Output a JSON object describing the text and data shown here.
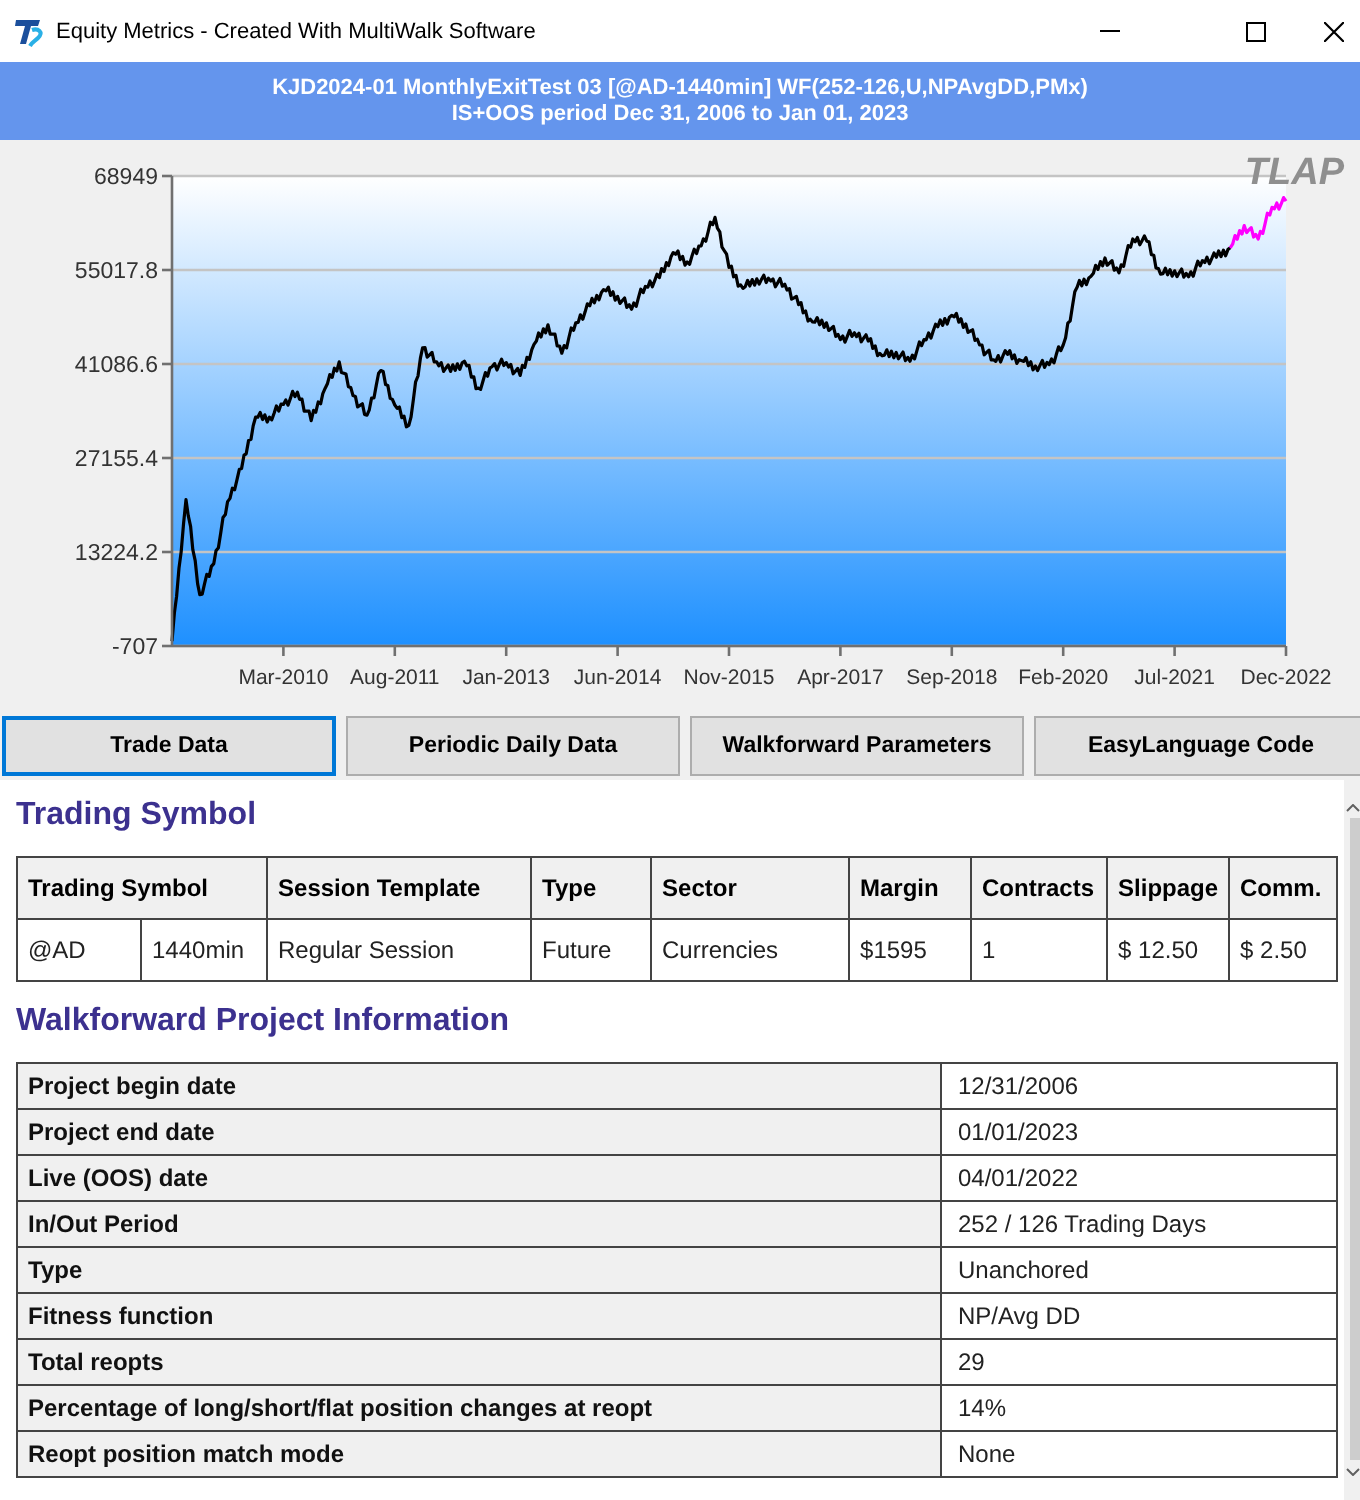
{
  "window": {
    "title": "Equity Metrics - Created With MultiWalk Software"
  },
  "header": {
    "title": "KJD2024-01 MonthlyExitTest 03 [@AD-1440min] WF(252-126,U,NPAvgDD,PMx)",
    "subtitle": "IS+OOS period Dec 31, 2006 to Jan 01, 2023"
  },
  "chart": {
    "corner_label": "TLAP",
    "chart_data": {
      "type": "line",
      "grid": true,
      "categories": [
        null,
        null,
        null,
        null,
        null,
        null,
        null,
        null,
        "Mar-2010",
        null,
        null,
        null,
        null,
        null,
        null,
        null,
        "Aug-2011",
        null,
        null,
        null,
        null,
        null,
        null,
        null,
        "Jan-2013",
        null,
        null,
        null,
        null,
        null,
        null,
        null,
        "Jun-2014",
        null,
        null,
        null,
        null,
        null,
        null,
        null,
        "Nov-2015",
        null,
        null,
        null,
        null,
        null,
        null,
        null,
        "Apr-2017",
        null,
        null,
        null,
        null,
        null,
        null,
        null,
        "Sep-2018",
        null,
        null,
        null,
        null,
        null,
        null,
        null,
        "Feb-2020",
        null,
        null,
        null,
        null,
        null,
        null,
        null,
        "Jul-2021",
        null,
        null,
        null,
        null,
        null,
        null,
        null,
        "Dec-2022"
      ],
      "series": [
        {
          "color": "#000000",
          "values": [
            0,
            21000,
            6900,
            11500,
            20700,
            25600,
            33200,
            33200,
            35100,
            36900,
            32700,
            37500,
            41400,
            36400,
            33500,
            40100,
            35000,
            32000,
            43500,
            41400,
            40000,
            41500,
            37500,
            40700,
            41300,
            39400,
            44000,
            46900,
            42700,
            47200,
            49700,
            52100,
            51100,
            49200,
            52600,
            53900,
            57600,
            56200,
            58600,
            62800,
            55400,
            52300,
            53700,
            53400,
            52900,
            49900,
            47300,
            47200,
            44700,
            45700,
            44500,
            42300,
            42800,
            41500,
            44700,
            46600,
            48300,
            47000,
            43900,
            41700,
            42500,
            41600,
            40800,
            41000,
            43900,
            52500,
            54100,
            56800,
            54600,
            59600,
            59300,
            54400,
            54900,
            54000,
            56400,
            56900,
            58300,
            null,
            null,
            null,
            null
          ]
        },
        {
          "color": "#ff00ff",
          "values": [
            null,
            null,
            null,
            null,
            null,
            null,
            null,
            null,
            null,
            null,
            null,
            null,
            null,
            null,
            null,
            null,
            null,
            null,
            null,
            null,
            null,
            null,
            null,
            null,
            null,
            null,
            null,
            null,
            null,
            null,
            null,
            null,
            null,
            null,
            null,
            null,
            null,
            null,
            null,
            null,
            null,
            null,
            null,
            null,
            null,
            null,
            null,
            null,
            null,
            null,
            null,
            null,
            null,
            null,
            null,
            null,
            null,
            null,
            null,
            null,
            null,
            null,
            null,
            null,
            null,
            null,
            null,
            null,
            null,
            null,
            null,
            null,
            null,
            null,
            null,
            null,
            58300,
            61600,
            59600,
            64300,
            65200
          ]
        }
      ],
      "ylim": [
        -707,
        68949
      ],
      "yticks": [
        -707,
        13224.2,
        27155.4,
        41086.6,
        55017.8,
        68949
      ]
    }
  },
  "tabs": [
    {
      "label": "Trade Data",
      "selected": true
    },
    {
      "label": "Periodic Daily Data",
      "selected": false
    },
    {
      "label": "Walkforward Parameters",
      "selected": false
    },
    {
      "label": "EasyLanguage Code",
      "selected": false
    }
  ],
  "trading_symbol": {
    "heading": "Trading Symbol",
    "columns": [
      {
        "label": "Trading Symbol",
        "colspan": 2
      },
      {
        "label": "Session Template"
      },
      {
        "label": "Type"
      },
      {
        "label": "Sector"
      },
      {
        "label": "Margin"
      },
      {
        "label": "Contracts"
      },
      {
        "label": "Slippage"
      },
      {
        "label": "Comm."
      }
    ],
    "rows": [
      [
        "@AD",
        "1440min",
        "Regular Session",
        "Future",
        "Currencies",
        "$1595",
        "1",
        "$ 12.50",
        "$ 2.50"
      ]
    ]
  },
  "walkforward": {
    "heading": "Walkforward Project Information",
    "rows": [
      {
        "label": "Project begin date",
        "value": "12/31/2006"
      },
      {
        "label": "Project end date",
        "value": "01/01/2023"
      },
      {
        "label": "Live (OOS) date",
        "value": "04/01/2022"
      },
      {
        "label": "In/Out Period",
        "value": "252 / 126 Trading Days"
      },
      {
        "label": "Type",
        "value": "Unanchored"
      },
      {
        "label": "Fitness function",
        "value": "NP/Avg DD"
      },
      {
        "label": "Total reopts",
        "value": "29"
      },
      {
        "label": "Percentage of long/short/flat position changes at reopt",
        "value": "14%"
      },
      {
        "label": "Reopt position match mode",
        "value": "None"
      }
    ]
  }
}
